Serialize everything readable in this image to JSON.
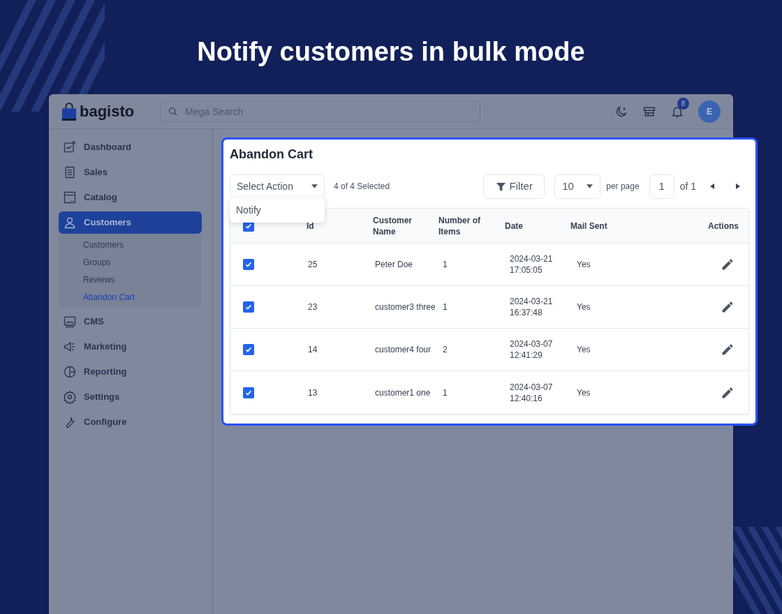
{
  "headline": "Notify customers in bulk mode",
  "header": {
    "logo": "bagisto",
    "search": {
      "placeholder": "Mega Search"
    },
    "notification_count": "8",
    "avatar": "E"
  },
  "sidebar": {
    "items": [
      {
        "label": "Dashboard",
        "selected": false
      },
      {
        "label": "Sales",
        "selected": false
      },
      {
        "label": "Catalog",
        "selected": false
      },
      {
        "label": "Customers",
        "selected": true,
        "children": [
          {
            "label": "Customers",
            "selected": false
          },
          {
            "label": "Groups",
            "selected": false
          },
          {
            "label": "Reviews",
            "selected": false
          },
          {
            "label": "Abandon Cart",
            "selected": true
          }
        ]
      },
      {
        "label": "CMS",
        "selected": false
      },
      {
        "label": "Marketing",
        "selected": false
      },
      {
        "label": "Reporting",
        "selected": false
      },
      {
        "label": "Settings",
        "selected": false
      },
      {
        "label": "Configure",
        "selected": false
      }
    ]
  },
  "card": {
    "title": "Abandon Cart",
    "action_select": {
      "label": "Select Action",
      "menu": [
        "Notify"
      ]
    },
    "selection_text": "4 of 4 Selected",
    "filter": "Filter",
    "per_page": {
      "value": "10",
      "label": "per page"
    },
    "pagination": {
      "page": "1",
      "total": "of 1"
    },
    "table": {
      "all_checked": true,
      "columns": [
        "Id",
        "Customer Name",
        "Number of Items",
        "Date",
        "Mail Sent",
        "Actions"
      ],
      "rows": [
        {
          "checked": true,
          "id": "25",
          "name": "Peter Doe",
          "items": "1",
          "date": "2024-03-21 17:05:05",
          "mail_sent": "Yes"
        },
        {
          "checked": true,
          "id": "23",
          "name": "customer3 three",
          "items": "1",
          "date": "2024-03-21 16:37:48",
          "mail_sent": "Yes"
        },
        {
          "checked": true,
          "id": "14",
          "name": "customer4 four",
          "items": "2",
          "date": "2024-03-07 12:41:29",
          "mail_sent": "Yes"
        },
        {
          "checked": true,
          "id": "13",
          "name": "customer1 one",
          "items": "1",
          "date": "2024-03-07 12:40:16",
          "mail_sent": "Yes"
        }
      ]
    }
  }
}
